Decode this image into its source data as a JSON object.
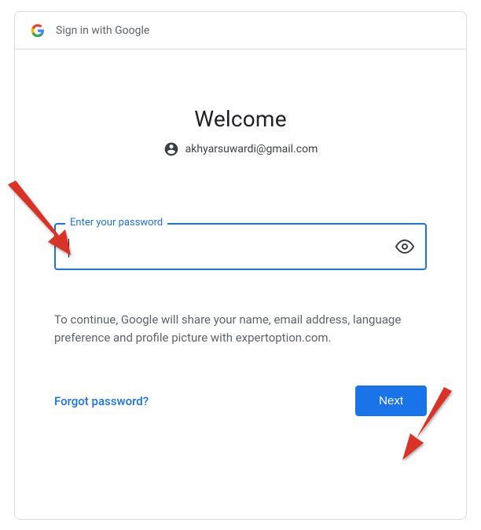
{
  "header": {
    "title": "Sign in with Google"
  },
  "welcome": {
    "title": "Welcome",
    "email": "akhyarsuwardi@gmail.com"
  },
  "password": {
    "label": "Enter your password",
    "value": ""
  },
  "consent": {
    "text": "To continue, Google will share your name, email address, language preference and profile picture with expertoption.com."
  },
  "actions": {
    "forgot": "Forgot password?",
    "next": "Next"
  }
}
